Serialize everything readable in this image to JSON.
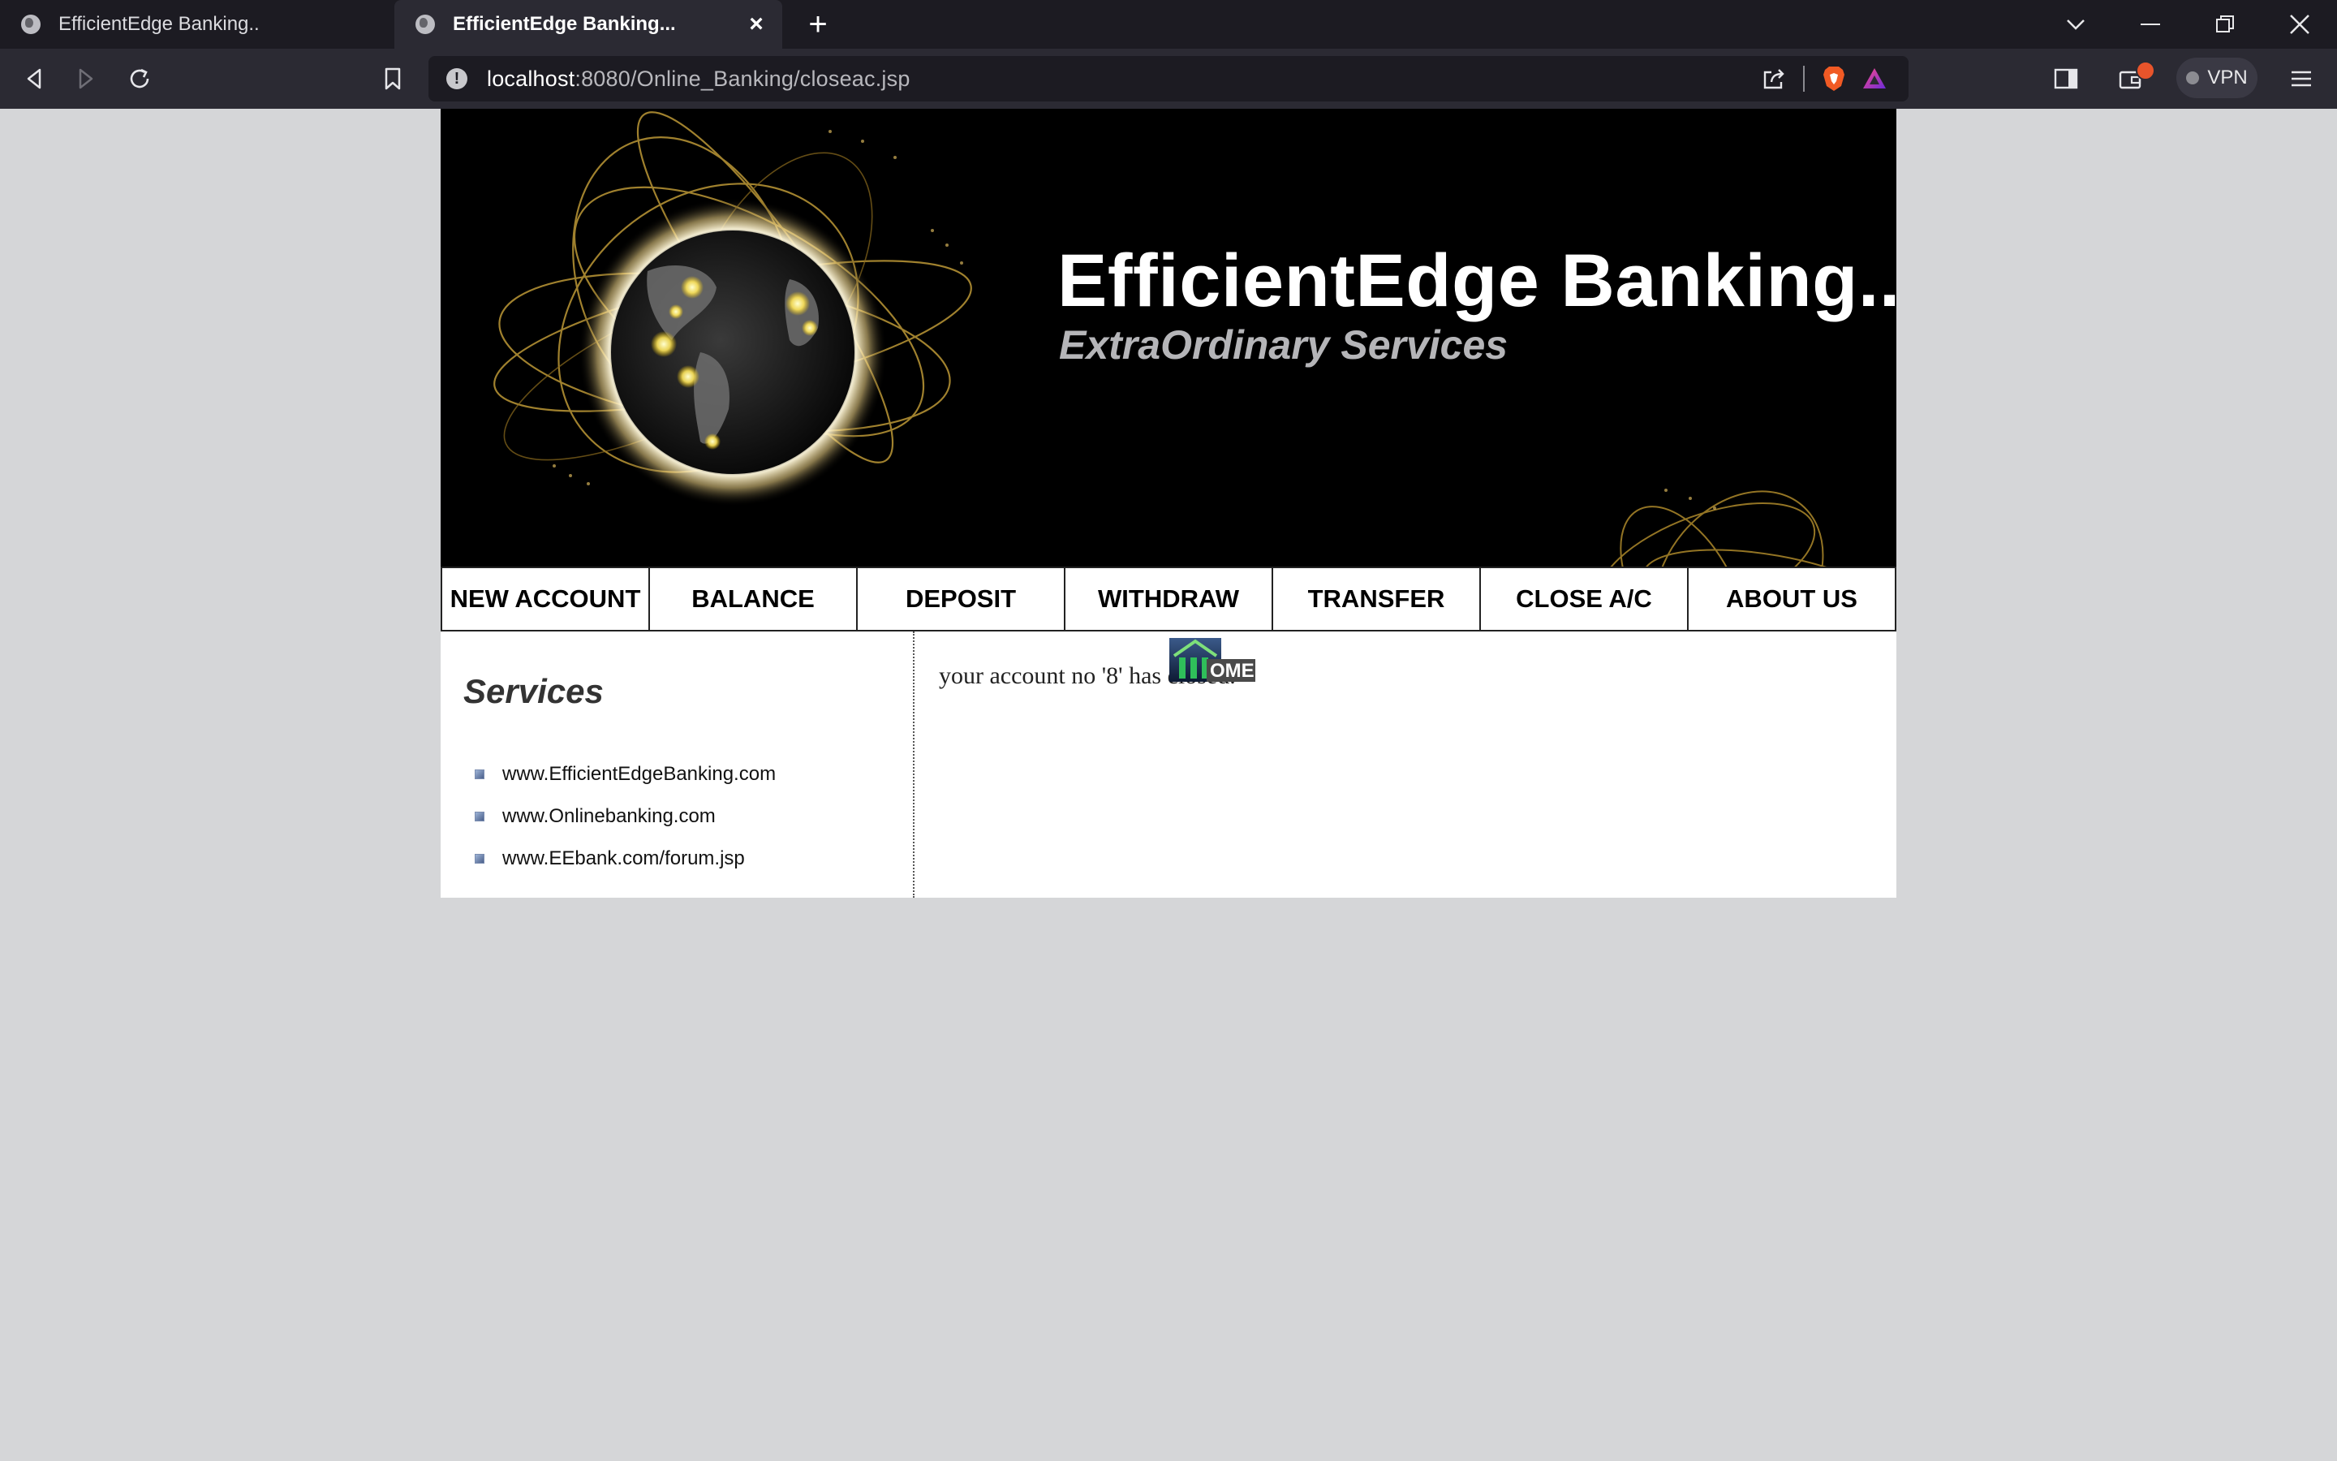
{
  "browser": {
    "tabs": [
      {
        "title": "EfficientEdge Banking..",
        "active": false
      },
      {
        "title": "EfficientEdge Banking...",
        "active": true
      }
    ],
    "url": {
      "host": "localhost",
      "path": ":8080/Online_Banking/closeac.jsp"
    },
    "vpn_label": "VPN"
  },
  "banner": {
    "title": "EfficientEdge Banking..",
    "subtitle": "ExtraOrdinary Services"
  },
  "menu": {
    "items": [
      {
        "label": "NEW ACCOUNT"
      },
      {
        "label": "BALANCE"
      },
      {
        "label": "DEPOSIT"
      },
      {
        "label": "WITHDRAW"
      },
      {
        "label": "TRANSFER"
      },
      {
        "label": "CLOSE A/C"
      },
      {
        "label": "ABOUT US"
      }
    ]
  },
  "sidebar": {
    "heading": "Services",
    "links": [
      {
        "label": "www.EfficientEdgeBanking.com"
      },
      {
        "label": "www.Onlinebanking.com"
      },
      {
        "label": "www.EEbank.com/forum.jsp"
      }
    ]
  },
  "main": {
    "message": "your account no '8' has closed.",
    "home_button_text": "OME"
  },
  "colors": {
    "chrome_dark": "#1c1b22",
    "chrome_toolbar": "#2b2a33",
    "page_background": "#d5d6d8",
    "banner_background": "#000000",
    "subtitle_gray": "#b5b5b8"
  }
}
